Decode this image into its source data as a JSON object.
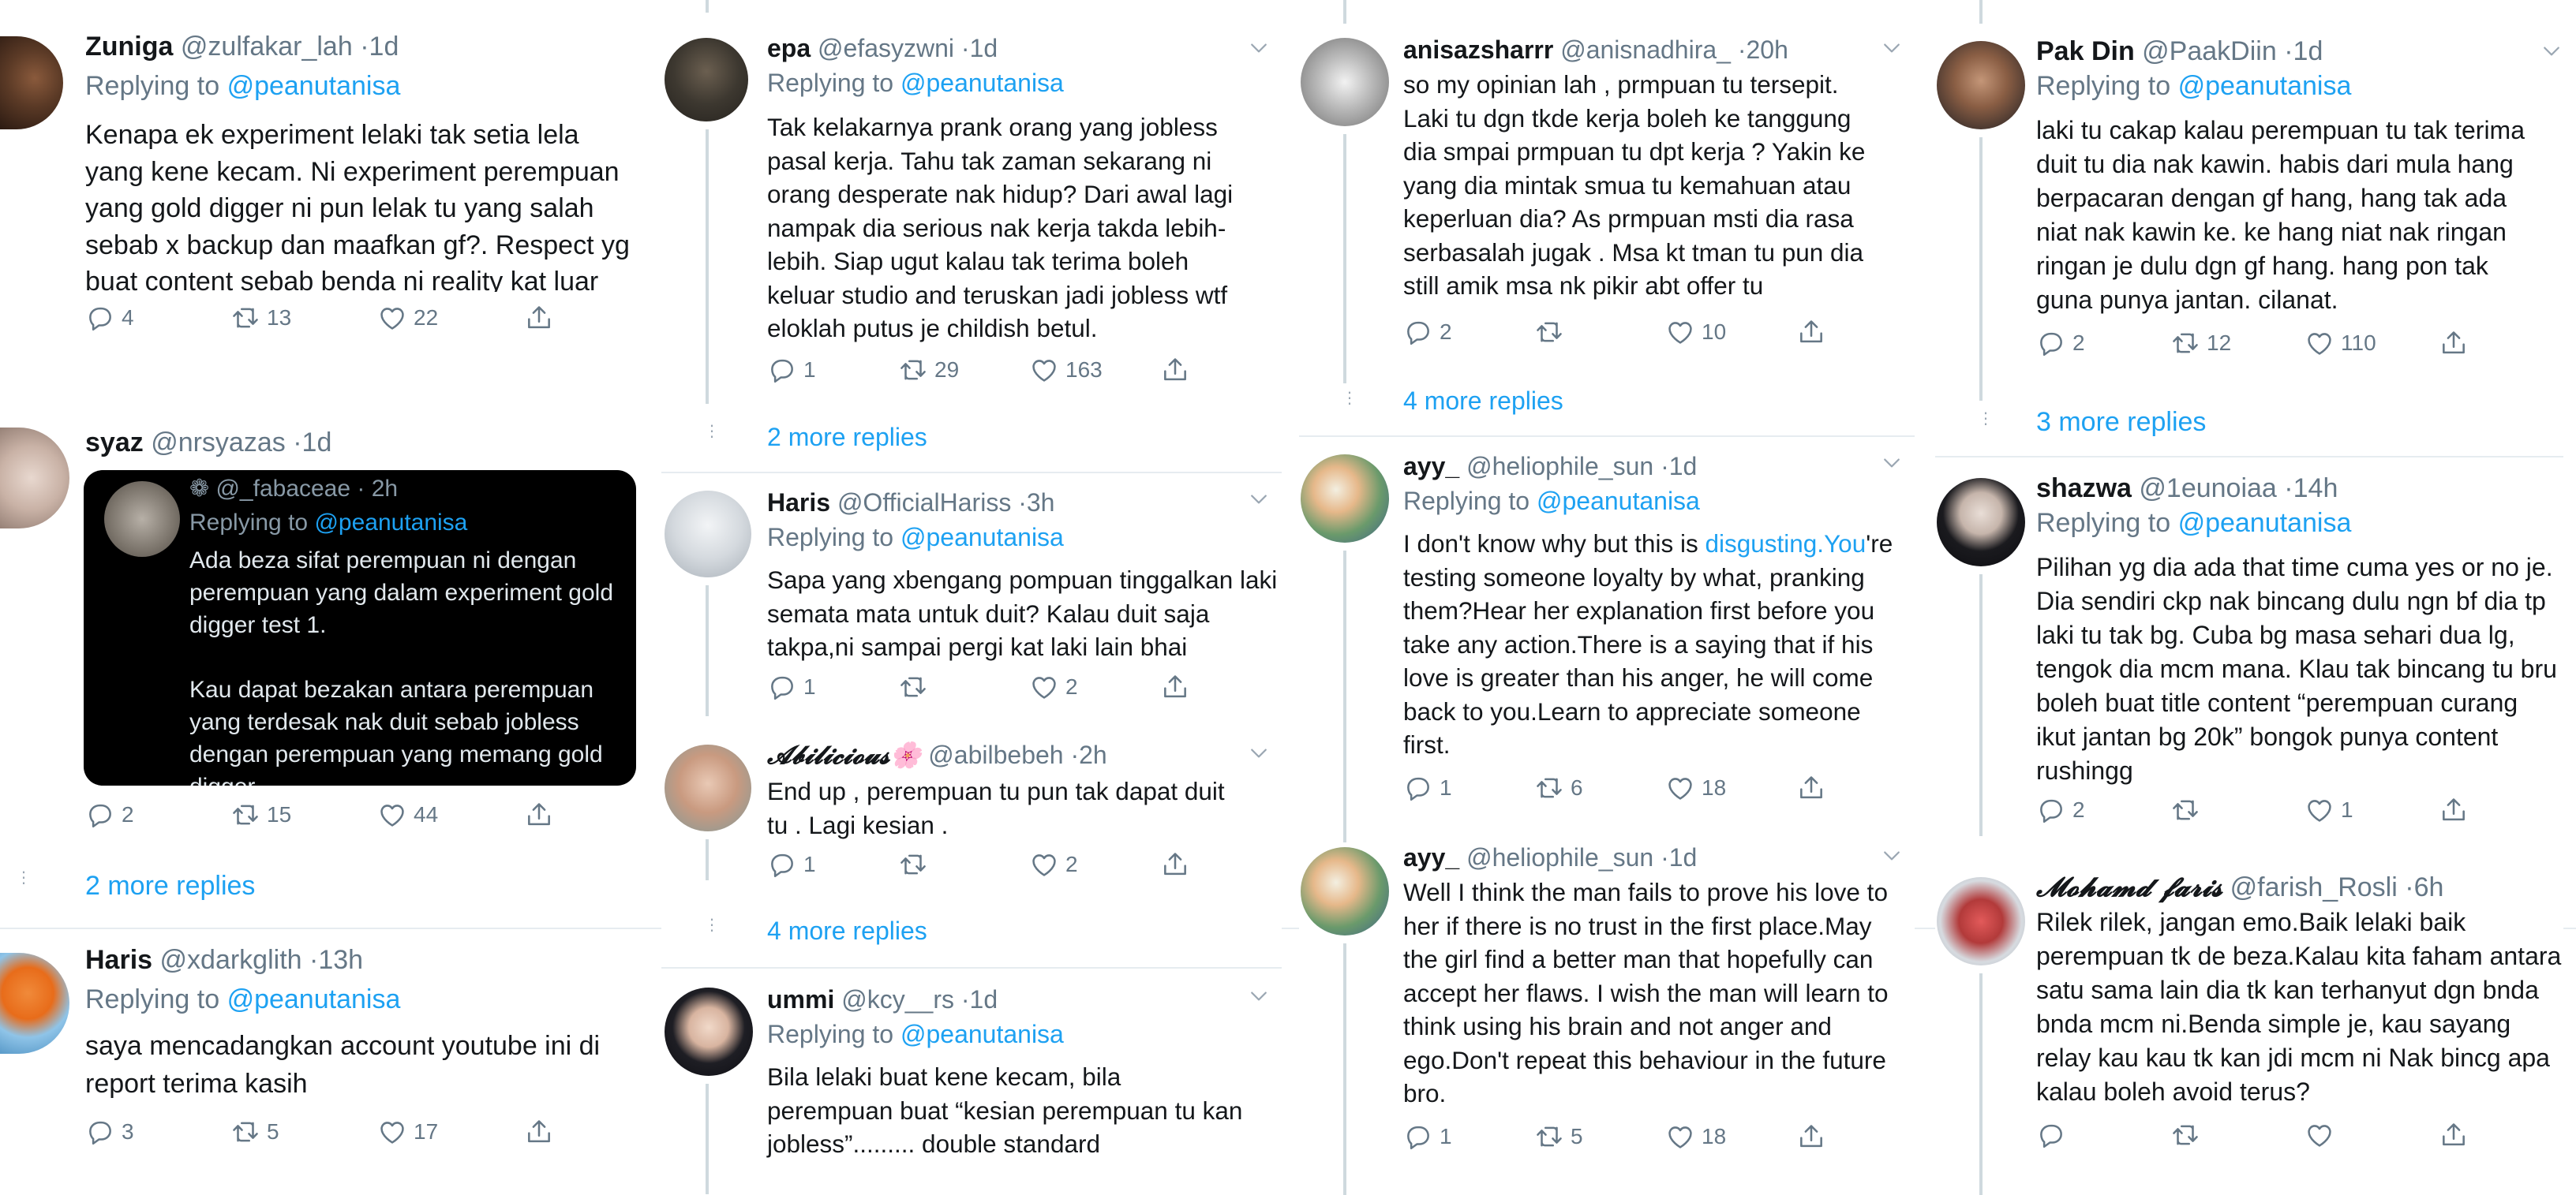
{
  "columns": [
    {
      "tweets": [
        {
          "name": "Zuniga",
          "handle": "@zulfakar_lah",
          "time": "1d",
          "replying_label": "Replying to",
          "replying_to": "@peanutanisa",
          "text": "Kenapa ek experiment lelaki tak setia lela yang kene kecam. Ni experiment perempuan yang gold digger ni pun lelak tu yang salah sebab x backup dan maafkan gf?. Respect yg buat content sebab benda ni reality kat luar sana.",
          "replies": "4",
          "retweets": "13",
          "likes": "22"
        },
        {
          "name": "syaz",
          "handle": "@nrsyazas",
          "time": "1d",
          "quote": {
            "header": "❁ @_fabaceae · 2h",
            "replying_label": "Replying to",
            "replying_to": "@peanutanisa",
            "text": "Ada beza sifat perempuan ni dengan perempuan yang dalam experiment gold digger test 1.\n\nKau dapat bezakan antara perempuan yang terdesak nak duit sebab jobless dengan perempuan yang memang gold digger"
          },
          "replies": "2",
          "retweets": "15",
          "likes": "44",
          "more_replies": "2 more replies"
        },
        {
          "name": "Haris",
          "handle": "@xdarkglith",
          "time": "13h",
          "replying_label": "Replying to",
          "replying_to": "@peanutanisa",
          "text": "saya mencadangkan account youtube ini di report terima kasih",
          "replies": "3",
          "retweets": "5",
          "likes": "17"
        }
      ]
    },
    {
      "tweets": [
        {
          "name": "epa",
          "handle": "@efasyzwni",
          "time": "1d",
          "replying_label": "Replying to",
          "replying_to": "@peanutanisa",
          "text": "Tak kelakarnya prank orang yang jobless pasal kerja. Tahu tak zaman sekarang ni orang desperate nak hidup? Dari awal lagi nampak dia serious nak kerja takda lebih-lebih. Siap ugut kalau tak terima boleh keluar studio and teruskan jadi jobless wtf eloklah putus je childish betul.",
          "replies": "1",
          "retweets": "29",
          "likes": "163",
          "more_replies": "2 more replies"
        },
        {
          "name": "Haris",
          "handle": "@OfficialHariss",
          "time": "3h",
          "replying_label": "Replying to",
          "replying_to": "@peanutanisa",
          "text": "Sapa yang xbengang pompuan tinggalkan laki semata mata untuk duit? Kalau duit saja takpa,ni sampai pergi kat laki lain bhai",
          "replies": "1",
          "retweets": "",
          "likes": "2"
        },
        {
          "name": "𝓐𝓫𝓲𝓵𝓲𝓬𝓲𝓸𝓾𝓼🌸",
          "handle": "@abilbebeh",
          "time": "2h",
          "text": "End up , perempuan tu pun tak dapat duit tu . Lagi kesian .",
          "replies": "1",
          "retweets": "",
          "likes": "2",
          "more_replies": "4 more replies"
        },
        {
          "name": "ummi",
          "handle": "@kcy__rs",
          "time": "1d",
          "replying_label": "Replying to",
          "replying_to": "@peanutanisa",
          "text": "Bila lelaki buat kene kecam, bila perempuan buat “kesian perempuan tu kan jobless”......... double standard"
        }
      ]
    },
    {
      "tweets": [
        {
          "name": "anisazsharrr",
          "handle": "@anisnadhira_",
          "time": "20h",
          "text": "so my opinian lah , prmpuan tu tersepit. Laki tu dgn tkde kerja boleh ke tanggung dia smpai prmpuan tu dpt kerja ? Yakin ke yang dia mintak smua tu kemahuan atau keperluan dia? As prmpuan msti dia rasa serbasalah jugak . Msa kt tman tu pun dia still amik msa nk pikir abt offer tu",
          "replies": "2",
          "retweets": "",
          "likes": "10",
          "more_replies": "4 more replies"
        },
        {
          "name": "ayy_",
          "handle": "@heliophile_sun",
          "time": "1d",
          "replying_label": "Replying to",
          "replying_to": "@peanutanisa",
          "text_pre": "I don't know why but this is",
          "text_link": "disgusting.You",
          "text_post": "'re testing someone loyalty by what, pranking them?Hear her explanation first before you take any action.There is a saying that if his love is greater than his anger, he will come back to you.Learn to appreciate someone first.",
          "replies": "1",
          "retweets": "6",
          "likes": "18"
        },
        {
          "name": "ayy_",
          "handle": "@heliophile_sun",
          "time": "1d",
          "text": "Well I think the man fails to prove his love to her if there is no trust in the first place.May the girl find a better man that hopefully can accept her flaws. I wish the man will learn to think using his brain and not anger and ego.Don't repeat this behaviour in the future bro.",
          "replies": "1",
          "retweets": "5",
          "likes": "18"
        }
      ]
    },
    {
      "tweets": [
        {
          "name": "Pak Din",
          "handle": "@PaakDiin",
          "time": "1d",
          "replying_label": "Replying to",
          "replying_to": "@peanutanisa",
          "text": "laki tu cakap kalau perempuan tu tak terima duit tu dia nak kawin. habis dari mula hang berpacaran dengan gf hang, hang tak ada niat nak kawin ke. ke hang niat nak ringan ringan je dulu dgn gf hang. hang pon tak guna punya jantan. cilanat.",
          "replies": "2",
          "retweets": "12",
          "likes": "110",
          "more_replies": "3 more replies"
        },
        {
          "name": "shazwa",
          "handle": "@1eunoiaa",
          "time": "14h",
          "replying_label": "Replying to",
          "replying_to": "@peanutanisa",
          "text": "Pilihan yg dia ada that time cuma yes or no je. Dia sendiri ckp nak bincang dulu ngn bf dia tp laki tu tak bg. Cuba bg masa sehari dua lg, tengok dia mcm mana. Klau tak bincang tu bru boleh buat title content “perempuan curang ikut jantan bg 20k” bongok punya content rushingg",
          "replies": "2",
          "retweets": "",
          "likes": "1"
        },
        {
          "name": "𝓜𝓸𝓱𝓪𝓶𝓭 𝓯𝓪𝓻𝓲𝓼",
          "handle": "@farish_Rosli",
          "time": "6h",
          "text": "Rilek rilek, jangan emo.Baik lelaki baik perempuan tk de beza.Kalau kita faham antara satu sama lain dia tk kan terhanyut dgn bnda bnda mcm ni.Benda simple je, kau sayang relay kau kau tk kan jdi mcm ni Nak bincg apa kalau boleh avoid terus?",
          "replies": "",
          "retweets": "",
          "likes": ""
        }
      ]
    }
  ]
}
